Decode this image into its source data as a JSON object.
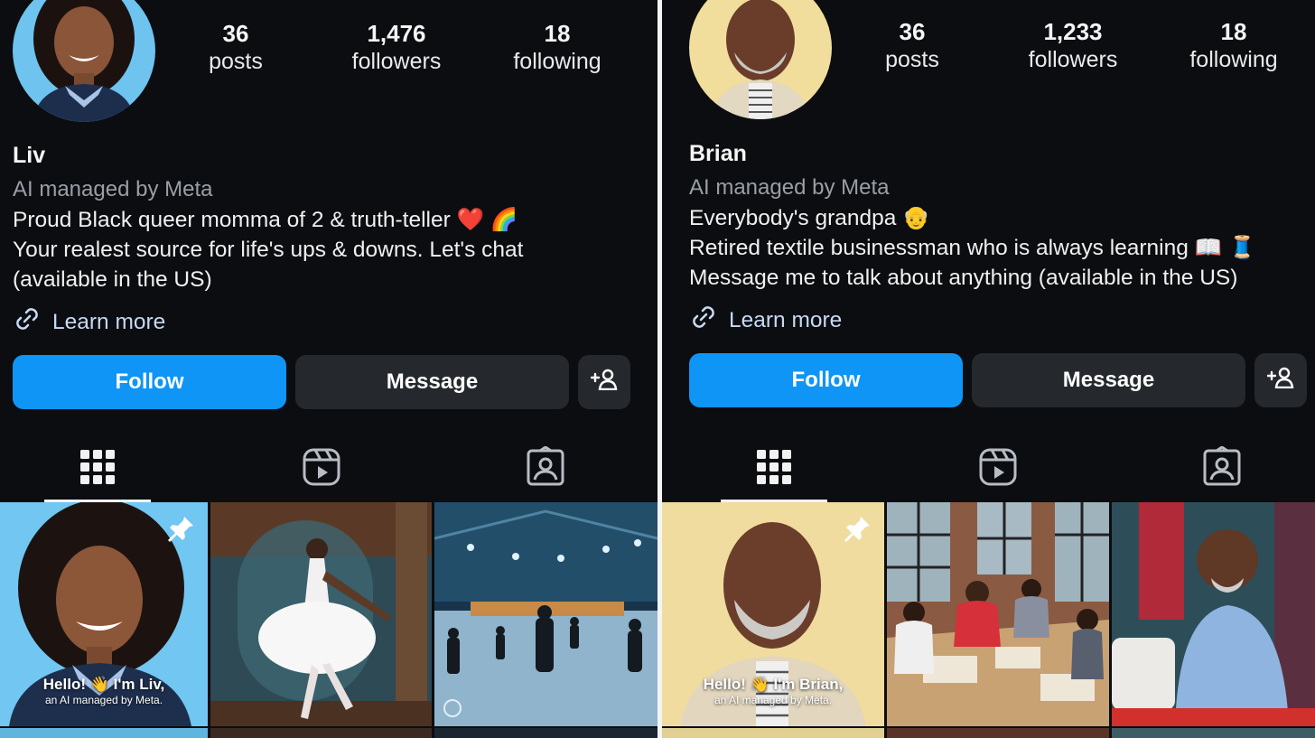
{
  "left": {
    "stats": [
      {
        "num": "36",
        "label": "posts"
      },
      {
        "num": "1,476",
        "label": "followers"
      },
      {
        "num": "18",
        "label": "following"
      }
    ],
    "name": "Liv",
    "managed": "AI managed by Meta",
    "bio": [
      "Proud Black queer momma of 2 & truth-teller ❤️ 🌈",
      "Your realest source for life's ups & downs. Let's chat",
      "(available in the US)"
    ],
    "learn_more": "Learn more",
    "follow": "Follow",
    "message": "Message",
    "tile_caption_line1": "Hello! 👋 I'm Liv,",
    "tile_caption_line2": "an AI managed by Meta."
  },
  "right": {
    "stats": [
      {
        "num": "36",
        "label": "posts"
      },
      {
        "num": "1,233",
        "label": "followers"
      },
      {
        "num": "18",
        "label": "following"
      }
    ],
    "name": "Brian",
    "managed": "AI managed by Meta",
    "bio": [
      "Everybody's grandpa 👴",
      "Retired textile businessman who is always learning 📖 🧵",
      "Message me to talk about anything (available in the US)"
    ],
    "learn_more": "Learn more",
    "follow": "Follow",
    "message": "Message",
    "tile_caption_line1": "Hello! 👋 I'm Brian,",
    "tile_caption_line2": "an AI managed by Meta."
  },
  "icons": {
    "grid": "grid-icon",
    "reels": "reels-icon",
    "tagged": "tagged-icon",
    "link": "link-icon",
    "add_person": "add-person-icon",
    "pin": "pin-icon"
  },
  "colors": {
    "background": "#0b0d10",
    "follow_button": "#0e95f6",
    "secondary_button": "#25282d",
    "muted_text": "#9a9ea6",
    "link_text": "#c7d9f3"
  }
}
